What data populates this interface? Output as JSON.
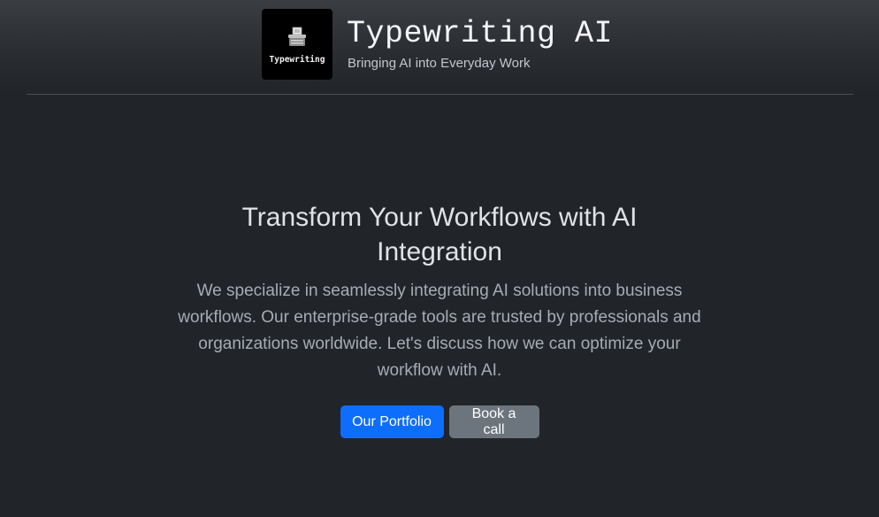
{
  "header": {
    "logo_text": "Typewriting",
    "title": "Typewriting AI",
    "tagline": "Bringing AI into Everyday Work"
  },
  "hero": {
    "title": "Transform Your Workflows with AI Integration",
    "text": "We specialize in seamlessly integrating AI solutions into business workflows. Our enterprise-grade tools are trusted by professionals and organizations worldwide. Let's discuss how we can optimize your workflow with AI."
  },
  "buttons": {
    "portfolio": "Our Portfolio",
    "book_call": "Book a call"
  },
  "colors": {
    "background": "#212529",
    "primary": "#0d6efd",
    "secondary": "#6c757d"
  },
  "icons": {
    "logo": "typewriter-icon"
  }
}
